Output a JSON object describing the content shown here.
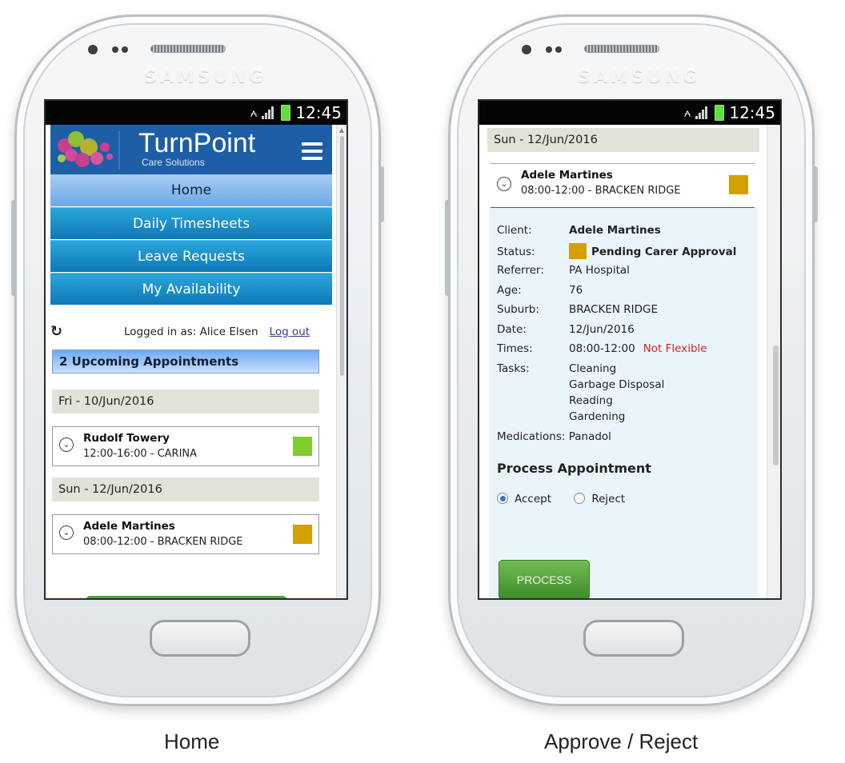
{
  "device": {
    "brand": "SAMSUNG",
    "clock": "12:45"
  },
  "captions": {
    "left": "Home",
    "right": "Approve / Reject"
  },
  "home": {
    "app_name": "TurnPoint",
    "tagline": "Care Solutions",
    "nav": [
      "Home",
      "Daily Timesheets",
      "Leave Requests",
      "My Availability"
    ],
    "logged_in_text": "Logged in as: Alice Elsen",
    "logout_label": "Log out",
    "upcoming_title": "2 Upcoming Appointments",
    "days": [
      {
        "label": "Fri - 10/Jun/2016",
        "appt": {
          "name": "Rudolf Towery",
          "time": "12:00-16:00 - CARINA",
          "color": "#7fcd2c"
        }
      },
      {
        "label": "Sun - 12/Jun/2016",
        "appt": {
          "name": "Adele Martines",
          "time": "08:00-12:00 - BRACKEN RIDGE",
          "color": "#d4a000"
        }
      }
    ]
  },
  "detail": {
    "day_label": "Sun - 12/Jun/2016",
    "appt_name": "Adele Martines",
    "appt_time": "08:00-12:00 - BRACKEN RIDGE",
    "status_color": "#d4a000",
    "fields": {
      "client_label": "Client:",
      "client": "Adele Martines",
      "status_label": "Status:",
      "status": "Pending Carer Approval",
      "referrer_label": "Referrer:",
      "referrer": "PA Hospital",
      "age_label": "Age:",
      "age": "76",
      "suburb_label": "Suburb:",
      "suburb": "BRACKEN RIDGE",
      "date_label": "Date:",
      "date": "12/Jun/2016",
      "times_label": "Times:",
      "times": "08:00-12:00",
      "flex": "Not Flexible",
      "tasks_label": "Tasks:",
      "tasks": [
        "Cleaning",
        "Garbage Disposal",
        "Reading",
        "Gardening"
      ],
      "medications_label": "Medications:",
      "medications": "Panadol"
    },
    "process_title": "Process Appointment",
    "accept_label": "Accept",
    "reject_label": "Reject",
    "process_button": "PROCESS"
  }
}
